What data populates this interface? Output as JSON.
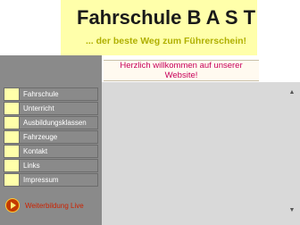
{
  "header": {
    "title": "Fahrschule B A S T",
    "slogan": "... der beste Weg zum Führerschein!"
  },
  "welcome": {
    "line1": "Herzlich willkommen auf unserer",
    "line2": "Website!"
  },
  "nav": {
    "items": [
      {
        "label": "Fahrschule"
      },
      {
        "label": "Unterricht"
      },
      {
        "label": "Ausbildungsklassen"
      },
      {
        "label": "Fahrzeuge"
      },
      {
        "label": "Kontakt"
      },
      {
        "label": "Links"
      },
      {
        "label": "Impressum"
      }
    ]
  },
  "promo": {
    "label": "Weiterbildung Live",
    "icon": "play-icon"
  },
  "colors": {
    "header_band": "#ffffaa",
    "slogan": "#b0b000",
    "welcome_text": "#c8005a",
    "sidebar": "#8a8a8a",
    "content": "#d9d9d9"
  }
}
